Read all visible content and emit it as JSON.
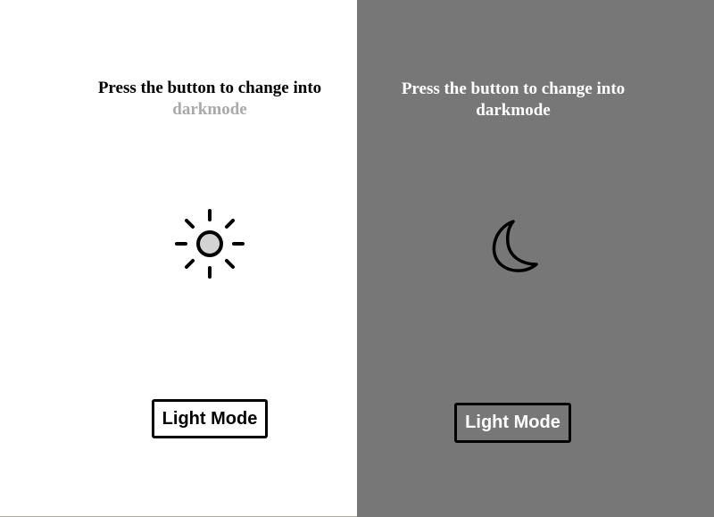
{
  "light_panel": {
    "prompt_line1": "Press the button to change into",
    "prompt_accent": "darkmode",
    "icon": "sun-icon",
    "button_label": "Light Mode",
    "colors": {
      "background": "#ffffff",
      "text": "#000000",
      "accent": "#a9a9a9",
      "sun_fill": "#d3d3d3"
    }
  },
  "dark_panel": {
    "prompt_line1": "Press the button to change into",
    "prompt_accent": "darkmode",
    "icon": "moon-icon",
    "button_label": "Light Mode",
    "colors": {
      "background": "#777777",
      "text": "#ffffff"
    }
  }
}
